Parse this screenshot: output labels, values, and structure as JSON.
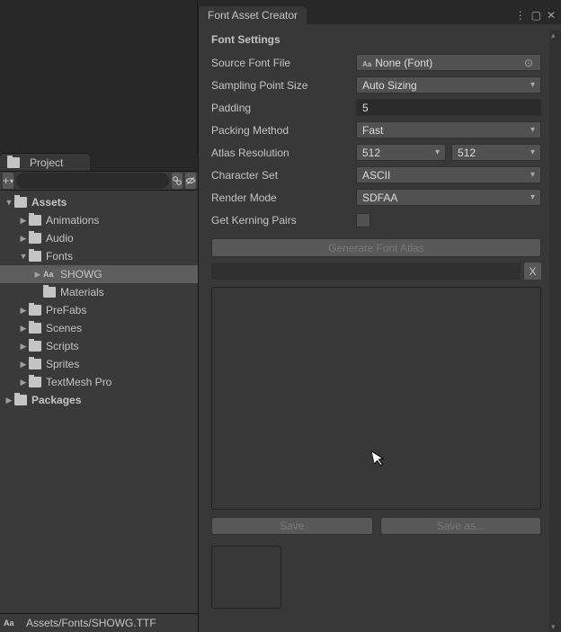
{
  "project": {
    "tab_label": "Project",
    "search_placeholder": "",
    "tree": {
      "assets": "Assets",
      "animations": "Animations",
      "audio": "Audio",
      "fonts": "Fonts",
      "showg": "SHOWG",
      "materials": "Materials",
      "prefabs": "PreFabs",
      "scenes": "Scenes",
      "scripts": "Scripts",
      "sprites": "Sprites",
      "textmeshpro": "TextMesh Pro",
      "packages": "Packages"
    },
    "status_path": "Assets/Fonts/SHOWG.TTF"
  },
  "creator": {
    "title": "Font Asset Creator",
    "section": "Font Settings",
    "labels": {
      "source": "Source Font File",
      "sampling": "Sampling Point Size",
      "padding": "Padding",
      "packing": "Packing Method",
      "atlas": "Atlas Resolution",
      "charset": "Character Set",
      "render": "Render Mode",
      "kerning": "Get Kerning Pairs"
    },
    "values": {
      "source": "None (Font)",
      "sampling": "Auto Sizing",
      "padding": "5",
      "packing": "Fast",
      "atlas_w": "512",
      "atlas_h": "512",
      "charset": "ASCII",
      "render": "SDFAA"
    },
    "buttons": {
      "generate": "Generate Font Atlas",
      "clear": "X",
      "save": "Save",
      "save_as": "Save as..."
    }
  }
}
